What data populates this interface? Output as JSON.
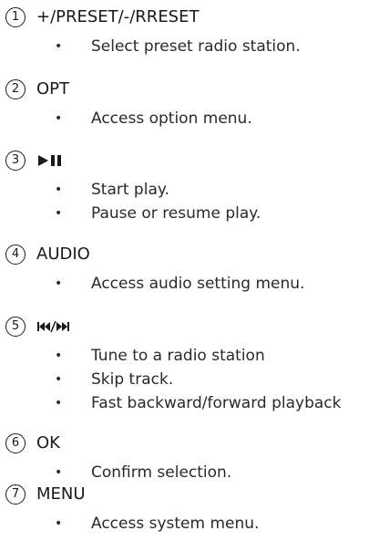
{
  "items": [
    {
      "number": "1",
      "key": "+/PRESET/-/RRESET",
      "bullets": [
        "Select preset radio station."
      ]
    },
    {
      "number": "2",
      "key": "OPT",
      "bullets": [
        "Access option menu."
      ]
    },
    {
      "number": "3",
      "key_icon": "play-pause-icon",
      "bullets": [
        "Start play.",
        "Pause or resume play."
      ]
    },
    {
      "number": "4",
      "key": "AUDIO",
      "bullets": [
        "Access audio setting menu."
      ]
    },
    {
      "number": "5",
      "key_icon": "previous-next-icon",
      "bullets": [
        "Tune to a radio station",
        "Skip track.",
        "Fast backward/forward playback"
      ]
    },
    {
      "number": "6",
      "key": "OK",
      "bullets": [
        "Confirm selection."
      ]
    },
    {
      "number": "7",
      "key": "MENU",
      "bullets": [
        "Access system menu."
      ]
    }
  ],
  "bullet_glyph": "•"
}
